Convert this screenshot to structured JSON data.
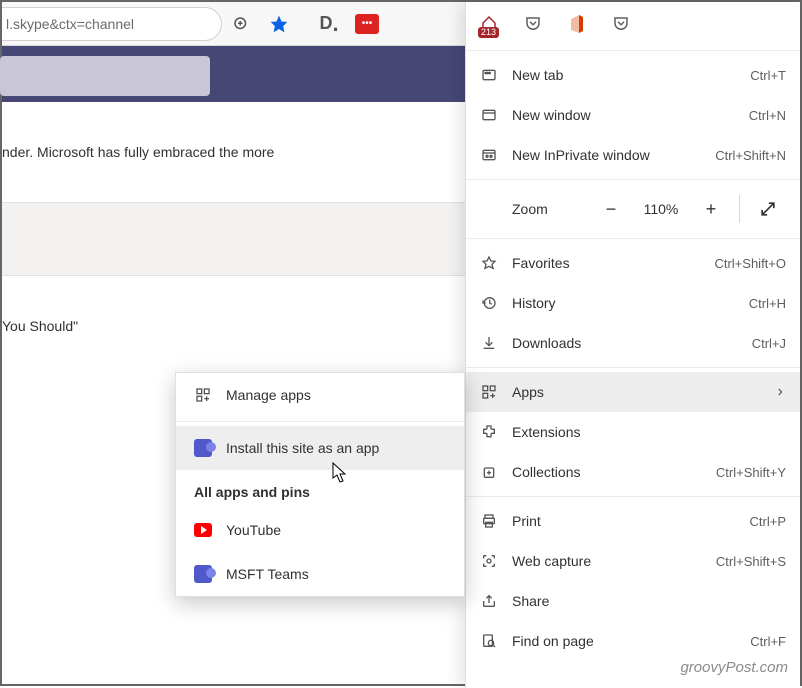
{
  "toolbar": {
    "url_fragment": "l.skype&ctx=channel"
  },
  "page": {
    "line1": "nder. Microsoft has fully embraced the more",
    "line2": "You Should\""
  },
  "pinbar": {
    "calendar_badge": "213"
  },
  "menu": {
    "new_tab": {
      "label": "New tab",
      "shortcut": "Ctrl+T"
    },
    "new_window": {
      "label": "New window",
      "shortcut": "Ctrl+N"
    },
    "new_inprivate": {
      "label": "New InPrivate window",
      "shortcut": "Ctrl+Shift+N"
    },
    "zoom": {
      "label": "Zoom",
      "value": "110%"
    },
    "favorites": {
      "label": "Favorites",
      "shortcut": "Ctrl+Shift+O"
    },
    "history": {
      "label": "History",
      "shortcut": "Ctrl+H"
    },
    "downloads": {
      "label": "Downloads",
      "shortcut": "Ctrl+J"
    },
    "apps": {
      "label": "Apps"
    },
    "extensions": {
      "label": "Extensions"
    },
    "collections": {
      "label": "Collections",
      "shortcut": "Ctrl+Shift+Y"
    },
    "print": {
      "label": "Print",
      "shortcut": "Ctrl+P"
    },
    "web_capture": {
      "label": "Web capture",
      "shortcut": "Ctrl+Shift+S"
    },
    "share": {
      "label": "Share"
    },
    "find": {
      "label": "Find on page",
      "shortcut": "Ctrl+F"
    }
  },
  "submenu": {
    "manage": "Manage apps",
    "install": "Install this site as an app",
    "heading": "All apps and pins",
    "youtube": "YouTube",
    "teams": "MSFT Teams"
  },
  "watermark": "groovyPost.com"
}
